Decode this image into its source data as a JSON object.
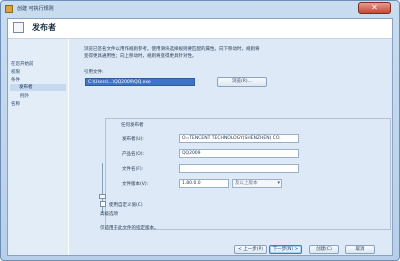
{
  "window": {
    "title": "创建 可执行规则",
    "close_label": "✕"
  },
  "header": {
    "title": "发布者"
  },
  "sidebar": {
    "items": [
      {
        "label": "在您开始前"
      },
      {
        "label": "权限"
      },
      {
        "label": "条件"
      },
      {
        "label": "发布者"
      },
      {
        "label": "例外"
      },
      {
        "label": "名称"
      }
    ]
  },
  "main": {
    "description_line1": "浏览已签名文件以用作规则参考。使用滑块选择规则要匹配的属性。向下移动时，规则将",
    "description_line2": "变得更具通用性；向上移动时，规则将变得更具针对性。",
    "reference_label": "引用文件:",
    "reference_path": "C:\\Users\\...\\QQ2009\\QQ.exe",
    "browse_label": "浏览(R)...",
    "any_publisher_label": "任何发布者",
    "publisher_label": "发布者(U):",
    "publisher_value": "O=TENCENT TECHNOLOGY(SHENZHEN) CO.",
    "product_label": "产品名(O):",
    "product_value": "QQ2009",
    "filename_label": "文件名(F):",
    "filename_value": "",
    "version_label": "文件版本(V):",
    "version_value": "1.80.0.0",
    "version_select": "及以上版本",
    "custom_values_label": "使用自定义值(C)",
    "advanced_label": "高级选项",
    "note": "仅适用于此文件的指定版本。"
  },
  "footer": {
    "prev_label": "< 上一步(P)",
    "next_label": "下一步(N) >",
    "create_label": "创建(C)",
    "cancel_label": "取消"
  }
}
